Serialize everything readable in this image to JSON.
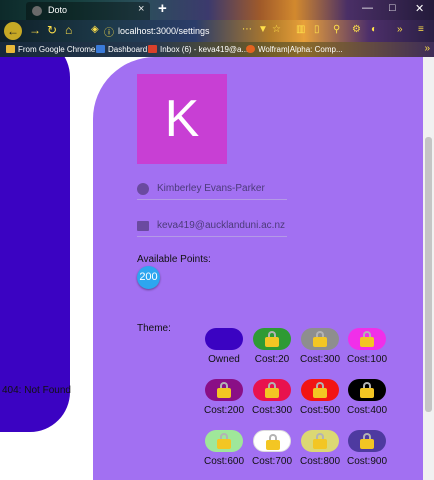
{
  "browser": {
    "tab_title": "Doto",
    "tab_close": "×",
    "new_tab": "+",
    "url": "localhost:3000/settings",
    "window_controls": {
      "minimize": "—",
      "maximize": "□",
      "close": "✕"
    },
    "bookmarks": [
      {
        "label": "From Google Chrome",
        "icon": "folder-icon",
        "color": "#e8b93a"
      },
      {
        "label": "Dashboard",
        "icon": "dashboard-icon",
        "color": "#3a7ad8"
      },
      {
        "label": "Inbox (6) - keva419@a...",
        "icon": "gmail-icon",
        "color": "#d9402b"
      },
      {
        "label": "Wolfram|Alpha: Comp...",
        "icon": "wolfram-icon",
        "color": "#e2631f"
      }
    ],
    "bookmarks_more": "»"
  },
  "sidebar": {
    "not_found": "404: Not Found",
    "color": "#3b03c2"
  },
  "profile": {
    "avatar_letter": "K",
    "avatar_color": "#c83fd4",
    "name": "Kimberley Evans-Parker",
    "email": "keva419@aucklanduni.ac.nz"
  },
  "points": {
    "label": "Available Points:",
    "value": "200"
  },
  "themes": {
    "label": "Theme:",
    "items": [
      {
        "color": "#3b03c2",
        "caption": "Owned",
        "locked": false
      },
      {
        "color": "#2e9a34",
        "caption": "Cost:20",
        "locked": true
      },
      {
        "color": "#8e8e8e",
        "caption": "Cost:300",
        "locked": true
      },
      {
        "color": "#f02fe9",
        "caption": "Cost:100",
        "locked": true
      },
      {
        "color": "#8a0f86",
        "caption": "Cost:200",
        "locked": true
      },
      {
        "color": "#e8124e",
        "caption": "Cost:300",
        "locked": true
      },
      {
        "color": "#f21414",
        "caption": "Cost:500",
        "locked": true
      },
      {
        "color": "#000000",
        "caption": "Cost:400",
        "locked": true
      },
      {
        "color": "#9fe79a",
        "caption": "Cost:600",
        "locked": true
      },
      {
        "color": "#ffffff",
        "caption": "Cost:700",
        "locked": true
      },
      {
        "color": "#dcd873",
        "caption": "Cost:800",
        "locked": true
      },
      {
        "color": "#4e3aa0",
        "caption": "Cost:900",
        "locked": true
      }
    ]
  }
}
